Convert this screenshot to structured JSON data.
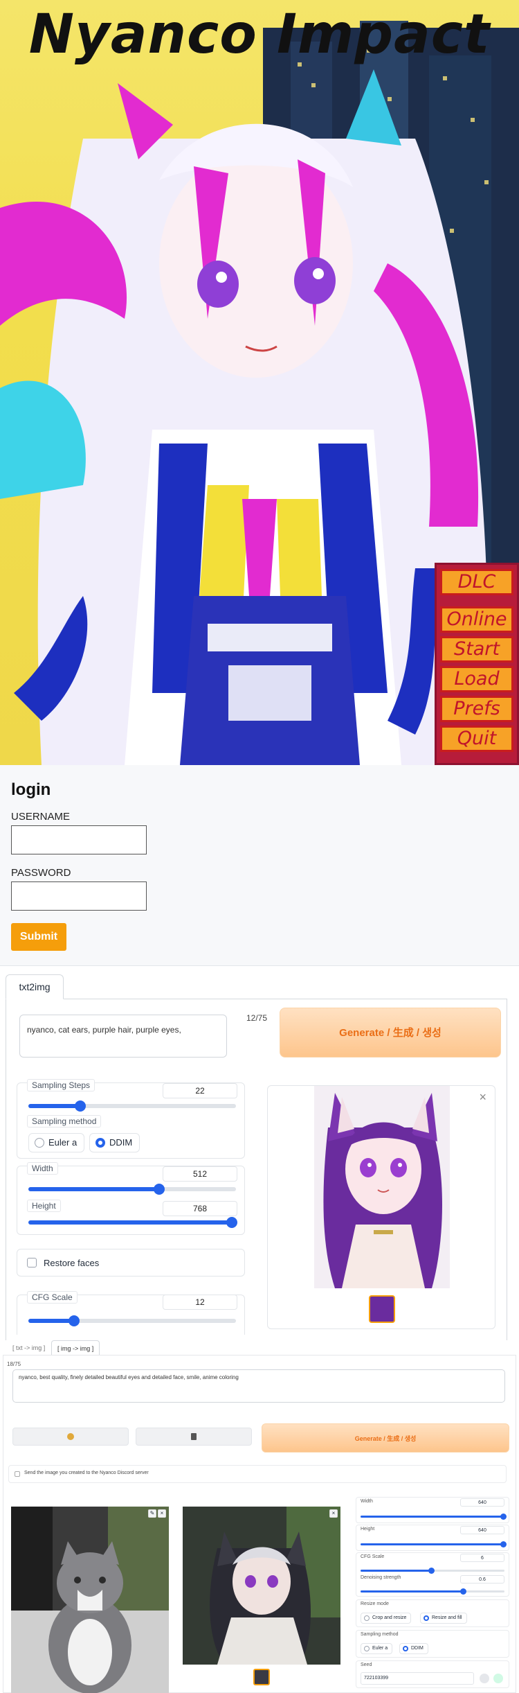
{
  "hero": {
    "title": "Nyanco Impact",
    "menu": [
      "DLC",
      "Online",
      "Start",
      "Load",
      "Prefs",
      "Quit"
    ]
  },
  "login": {
    "heading": "login",
    "username_label": "USERNAME",
    "password_label": "PASSWORD",
    "submit_label": "Submit"
  },
  "txt2img": {
    "tab_label": "txt2img",
    "prompt": "nyanco, cat ears, purple hair, purple eyes,",
    "token_count": "12/75",
    "generate_label": "Generate / 生成 / 생성",
    "sampling_steps": {
      "label": "Sampling Steps",
      "value": "22",
      "fraction": 0.25
    },
    "sampling_method": {
      "label": "Sampling method",
      "options": [
        "Euler a",
        "DDIM"
      ],
      "selected": "DDIM"
    },
    "width": {
      "label": "Width",
      "value": "512",
      "fraction": 0.63
    },
    "height": {
      "label": "Height",
      "value": "768",
      "fraction": 0.98
    },
    "restore_faces_label": "Restore faces",
    "cfg_scale": {
      "label": "CFG Scale",
      "value": "12",
      "fraction": 0.22
    },
    "close_glyph": "×"
  },
  "img2img": {
    "tabs": [
      "[ txt -> img ]",
      "[ img -> img ]"
    ],
    "token_count": "18/75",
    "prompt": "nyanco, best quality, finely detailed beautiful eyes and detailed face, smile, anime coloring",
    "generate_label": "Generate / 生成 / 생성",
    "send_label": "Send the image you created to the Nyanco Discord server",
    "width": {
      "label": "Width",
      "value": "640",
      "fraction": 0.99
    },
    "height": {
      "label": "Height",
      "value": "640",
      "fraction": 0.99
    },
    "cfg": {
      "label": "CFG Scale",
      "value": "6",
      "fraction": 0.49
    },
    "denoise": {
      "label": "Denoising strength",
      "value": "0.6",
      "fraction": 0.71
    },
    "resize_mode": {
      "label": "Resize mode",
      "options": [
        "Crop and resize",
        "Resize and fill"
      ],
      "selected": "Resize and fill"
    },
    "sampling_method": {
      "label": "Sampling method",
      "options": [
        "Euler a",
        "DDIM"
      ],
      "selected": "DDIM"
    },
    "seed": {
      "label": "Seed",
      "value": "722103399"
    }
  },
  "colors": {
    "accent": "#2563eb",
    "orange": "#f59e0b",
    "generate_text": "#ea6e16",
    "menu_bg": "#b71c3a"
  }
}
